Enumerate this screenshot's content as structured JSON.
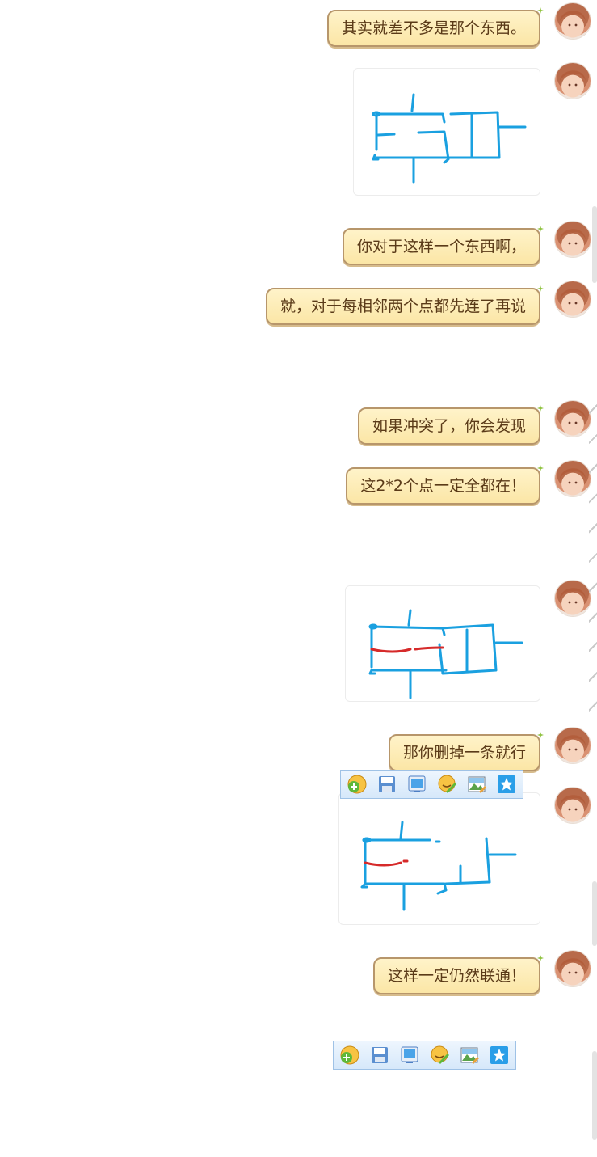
{
  "chat": {
    "messages": [
      {
        "type": "text",
        "text": "其实就差不多是那个东西。"
      },
      {
        "type": "image",
        "alt": "sketch-1"
      },
      {
        "type": "text",
        "text": "你对于这样一个东西啊，"
      },
      {
        "type": "text",
        "text": "就，对于每相邻两个点都先连了再说"
      },
      {
        "type": "text",
        "text": "如果冲突了，你会发现"
      },
      {
        "type": "text",
        "text": "这2*2个点一定全都在！"
      },
      {
        "type": "image",
        "alt": "sketch-2"
      },
      {
        "type": "text",
        "text": "那你删掉一条就行"
      },
      {
        "type": "image",
        "alt": "sketch-3"
      },
      {
        "type": "text",
        "text": "这样一定仍然联通！"
      }
    ]
  },
  "toolbar": {
    "buttons": [
      {
        "icon": "emoji-add-icon"
      },
      {
        "icon": "save-icon"
      },
      {
        "icon": "screen-icon"
      },
      {
        "icon": "emoji-edit-icon"
      },
      {
        "icon": "image-edit-icon"
      },
      {
        "icon": "favorite-star-icon"
      }
    ]
  },
  "colors": {
    "bubble_fill": "#fbe6a6",
    "bubble_border": "#b7966b",
    "bubble_text": "#5a3a18",
    "sketch_blue": "#1aa0e0",
    "sketch_red": "#d62a2a",
    "toolbar_fill": "#d6e8fa"
  }
}
